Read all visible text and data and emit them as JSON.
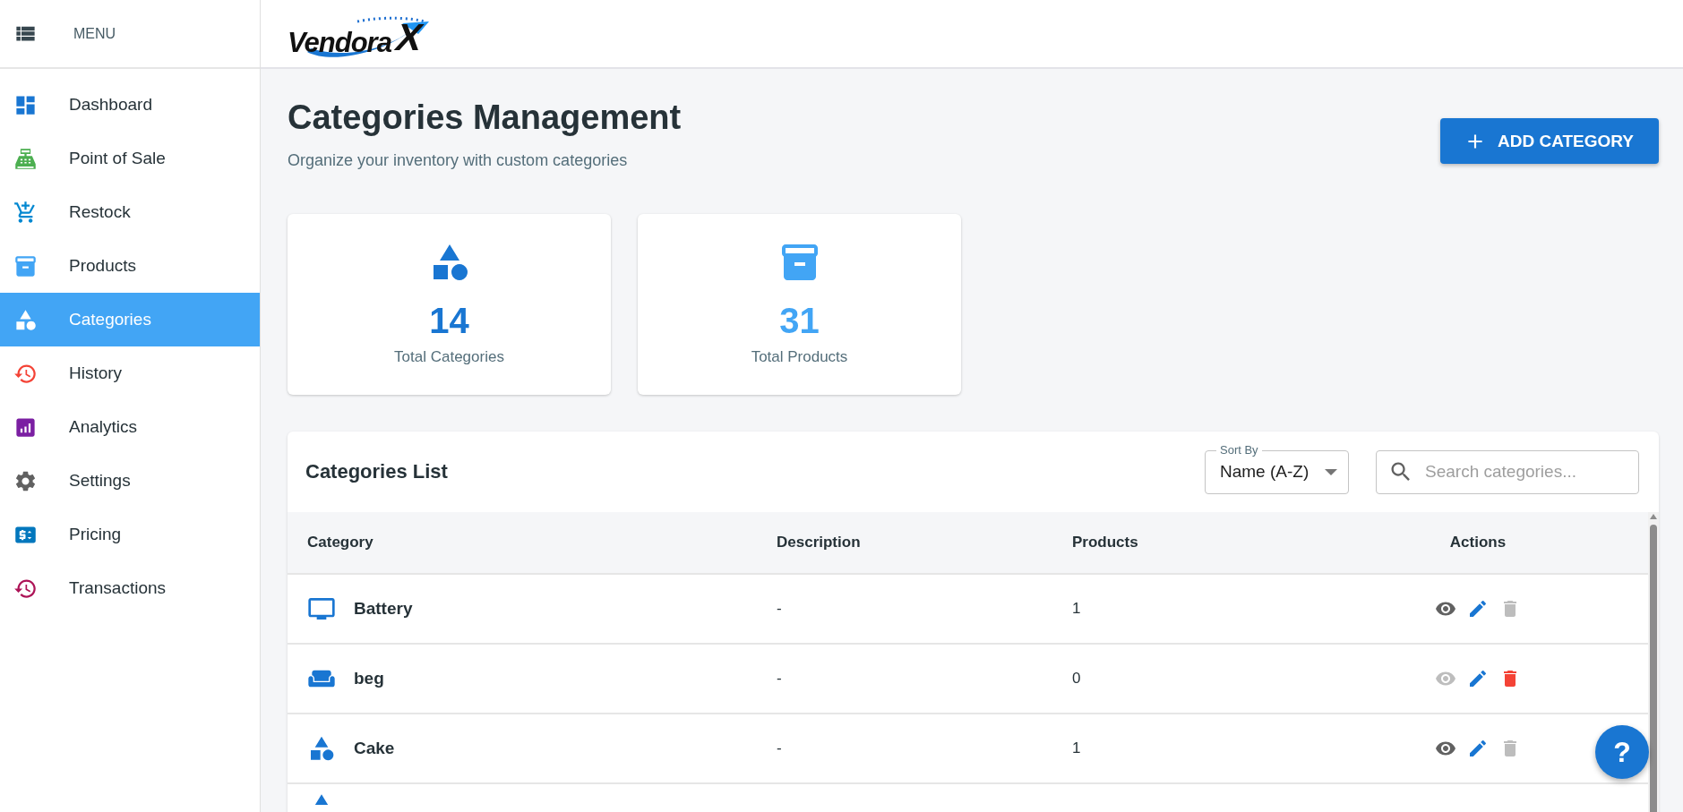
{
  "sidebar": {
    "menu_label": "MENU",
    "items": [
      {
        "label": "Dashboard",
        "kind": "dashboard",
        "color": "#1976d2",
        "selected": false
      },
      {
        "label": "Point of Sale",
        "kind": "register",
        "color": "#4caf50",
        "selected": false
      },
      {
        "label": "Restock",
        "kind": "cart",
        "color": "#0288d1",
        "selected": false
      },
      {
        "label": "Products",
        "kind": "archive",
        "color": "#42a5f5",
        "selected": false
      },
      {
        "label": "Categories",
        "kind": "shapes",
        "selected": true
      },
      {
        "label": "History",
        "kind": "history",
        "color": "#f44336",
        "selected": false
      },
      {
        "label": "Analytics",
        "kind": "analytics",
        "color": "#7b1fa2",
        "selected": false
      },
      {
        "label": "Settings",
        "kind": "gear",
        "color": "#616161",
        "selected": false
      },
      {
        "label": "Pricing",
        "kind": "price",
        "color": "#0277bd",
        "selected": false
      },
      {
        "label": "Transactions",
        "kind": "history",
        "color": "#ad1457",
        "selected": false
      }
    ]
  },
  "header": {
    "logo": {
      "text": "Vendora",
      "mark": "X"
    }
  },
  "page": {
    "title": "Categories Management",
    "subtitle": "Organize your inventory with custom categories",
    "add_button": "ADD CATEGORY"
  },
  "stats": [
    {
      "kind": "shapes",
      "color": "#1976d2",
      "value": "14",
      "label": "Total Categories"
    },
    {
      "kind": "archive",
      "color": "#42a5f5",
      "value": "31",
      "label": "Total Products"
    }
  ],
  "table": {
    "title": "Categories List",
    "sort": {
      "label": "Sort By",
      "value": "Name (A-Z)"
    },
    "search": {
      "placeholder": "Search categories..."
    },
    "columns": [
      "Category",
      "Description",
      "Products",
      "Actions"
    ],
    "rows": [
      {
        "kind": "monitor",
        "name": "Battery",
        "description": "-",
        "products": "1",
        "can_view": true,
        "can_delete": false
      },
      {
        "kind": "sofa",
        "name": "beg",
        "description": "-",
        "products": "0",
        "can_view": false,
        "can_delete": true
      },
      {
        "kind": "shapes",
        "name": "Cake",
        "description": "-",
        "products": "1",
        "can_view": true,
        "can_delete": false
      },
      {
        "kind": "shapes"
      }
    ]
  },
  "help_button": "?"
}
